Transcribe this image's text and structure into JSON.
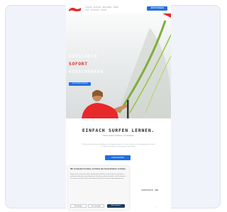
{
  "header": {
    "nav_items": [
      "KURSE",
      "SURFEN",
      "ERLEBEN",
      "ÜBER UNS",
      "KONTAKT",
      "SHOP"
    ],
    "cta_label": "JETZT BUCHEN"
  },
  "hero": {
    "line1": "GUTSCHEIN",
    "line2": "SOFORT",
    "line3": "VERSCHENKEN",
    "button_label": "GUTSCHEIN KAUFEN"
  },
  "intro": {
    "title": "EINFACH SURFEN LERNEN.",
    "subtitle": "Mit den besten Surflehrern am Gardasee",
    "body": "Wir bieten Windsurfkurse für Anfänger und Fortgeschrittene an. Unsere erfahrenen Lehrer begleiten dich Schritt für Schritt aufs Wasser und zu deinem ersten Erfolg.",
    "button_label": "KURS BUCHEN"
  },
  "next_section": {
    "label": "SURFKURSE UND"
  },
  "cookie": {
    "title": "Wir verwenden Cookies, um Ihnen das beste Erlebnis zu bieten.",
    "body": "Einige Cookies sind notwendig für den Betrieb der Website, andere helfen uns, die Seite zu verbessern und Inhalte zu personalisieren. Sie können selbst entscheiden, welche Kategorien Sie zulassen möchten. Weitere Informationen finden Sie in unserer Datenschutzerklärung.",
    "btn_settings": "Einstellungen",
    "btn_reject": "Nur notwendige",
    "btn_accept": "Alle akzeptieren"
  },
  "colors": {
    "accent": "#1f6fe0",
    "brand_red": "#e8282a",
    "cookie_accept": "#1f3b63"
  },
  "icons": [
    "brand-logo",
    "scroll-top-icon"
  ]
}
